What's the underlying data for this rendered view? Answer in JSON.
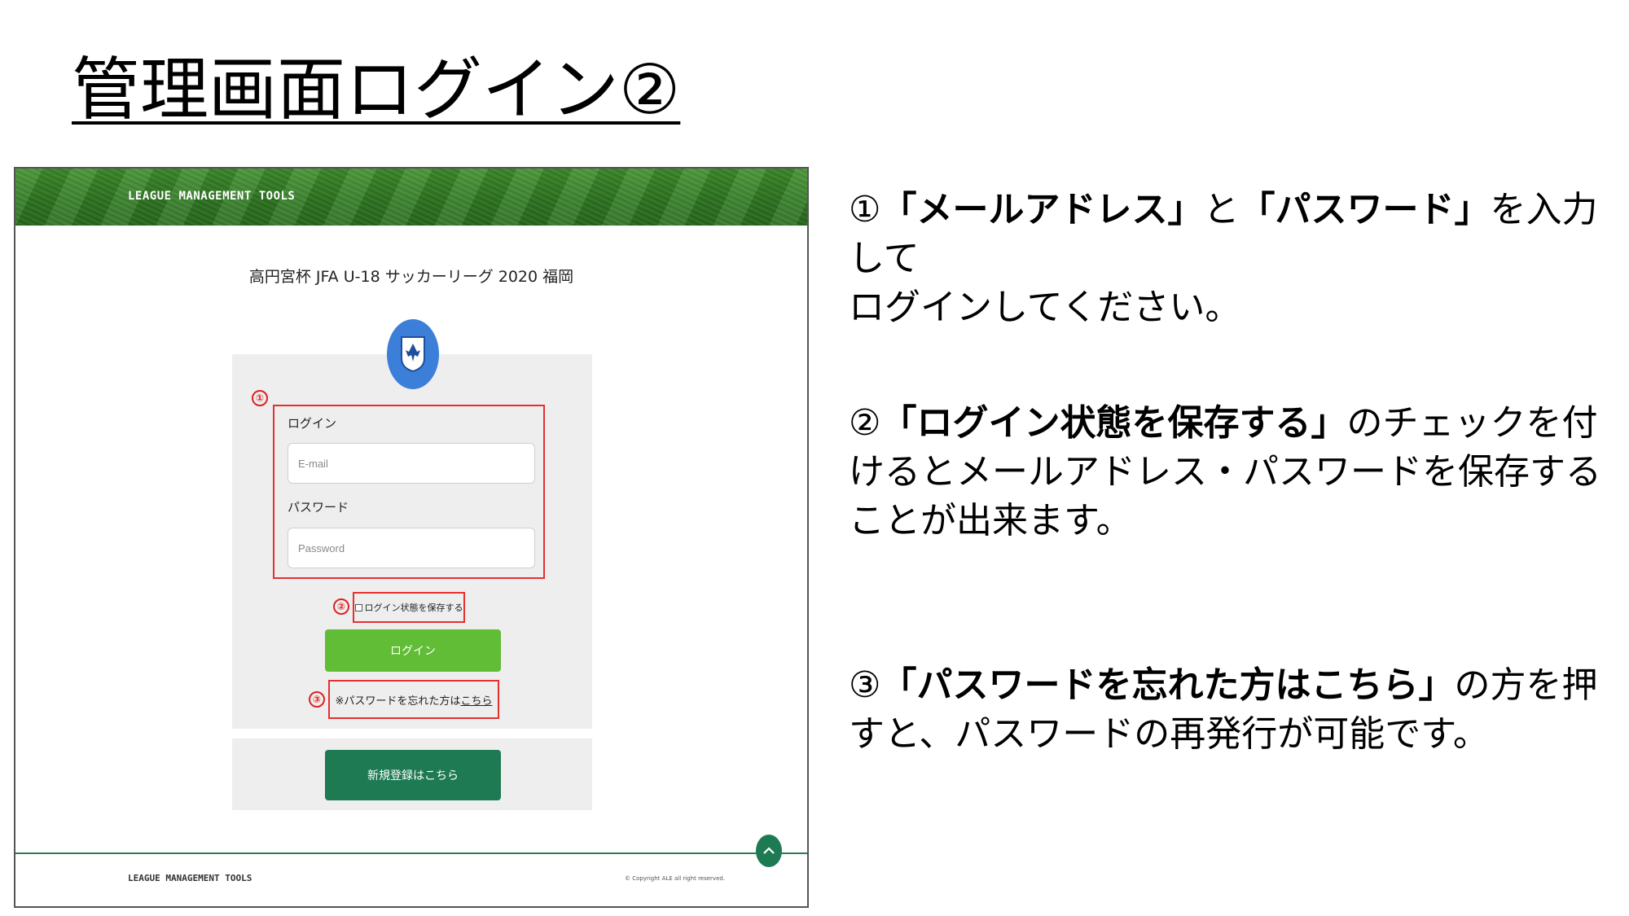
{
  "slide": {
    "title": "管理画面ログイン②"
  },
  "screen": {
    "brand": "LEAGUE MANAGEMENT TOOLS",
    "league_name": "高円宮杯 JFA U-18 サッカーリーグ 2020 福岡",
    "login_label": "ログイン",
    "email_placeholder": "E-mail",
    "password_label": "パスワード",
    "password_placeholder": "Password",
    "remember_label": "ログイン状態を保存する",
    "login_button": "ログイン",
    "forgot_prefix": "※パスワードを忘れた方は",
    "forgot_link": "こちら",
    "register_button": "新規登録はこちら",
    "footer_brand": "LEAGUE MANAGEMENT TOOLS",
    "copyright": "© Copyright ALE all right reserved.",
    "callouts": [
      "①",
      "②",
      "③"
    ]
  },
  "instructions": [
    {
      "num": "①",
      "highlight_a": "「メールアドレス」",
      "mid": "と",
      "highlight_b": "「パスワード」",
      "line1_rest": "を入力して",
      "line2": "ログインしてください。"
    },
    {
      "num": "②",
      "highlight": "「ログイン状態を保存する」",
      "line1_rest": "のチェックを付",
      "line2": "けるとメールアドレス・パスワードを保存する",
      "line3": "ことが出来ます。"
    },
    {
      "num": "③",
      "highlight": "「パスワードを忘れた方はこちら」",
      "line1_rest": "の方を押",
      "line2": "すと、パスワードの再発行が可能です。"
    }
  ],
  "colors": {
    "header_green": "#2f7a22",
    "callout_red": "#e53030",
    "login_green": "#61bd36",
    "register_green": "#1e7a52",
    "logo_blue": "#3b7fd9",
    "panel_gray": "#eeeeee"
  },
  "icons": {
    "logo": "jfa-crest-icon",
    "scroll_top": "chevron-up-icon"
  }
}
